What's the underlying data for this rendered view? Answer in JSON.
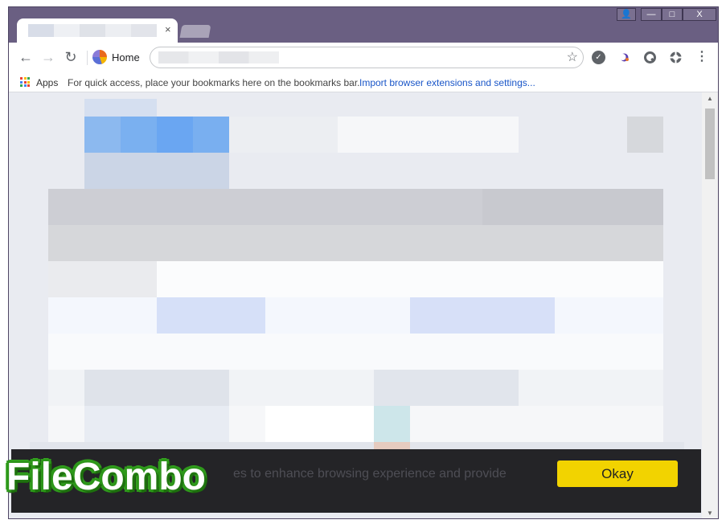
{
  "window": {
    "controls": {
      "user": "👤",
      "minimize": "—",
      "maximize": "□",
      "close": "X"
    }
  },
  "tab": {
    "close_glyph": "×"
  },
  "toolbar": {
    "back_glyph": "←",
    "forward_glyph": "→",
    "reload_glyph": "↻",
    "home_label": "Home",
    "bookmark_star": "☆",
    "menu_glyph": "⋮"
  },
  "bookmarks_bar": {
    "apps_label": "Apps",
    "hint": "For quick access, place your bookmarks here on the bookmarks bar.",
    "import_link": "Import browser extensions and settings..."
  },
  "cookie_banner": {
    "message": "es to enhance browsing experience and provide",
    "okay_label": "Okay"
  },
  "watermark": {
    "text": "FileCombo"
  },
  "colors": {
    "titlebar": "#6a5f82",
    "accent_blue": "#1a56c8",
    "okay_button": "#f2d300",
    "banner_bg": "#242427"
  },
  "icons": {
    "apps": "apps-grid-icon",
    "home": "home-logo-icon",
    "star": "star-icon",
    "extensions": [
      "check-circle-icon",
      "eclipse-icon",
      "q-icon",
      "crosshair-icon"
    ]
  }
}
